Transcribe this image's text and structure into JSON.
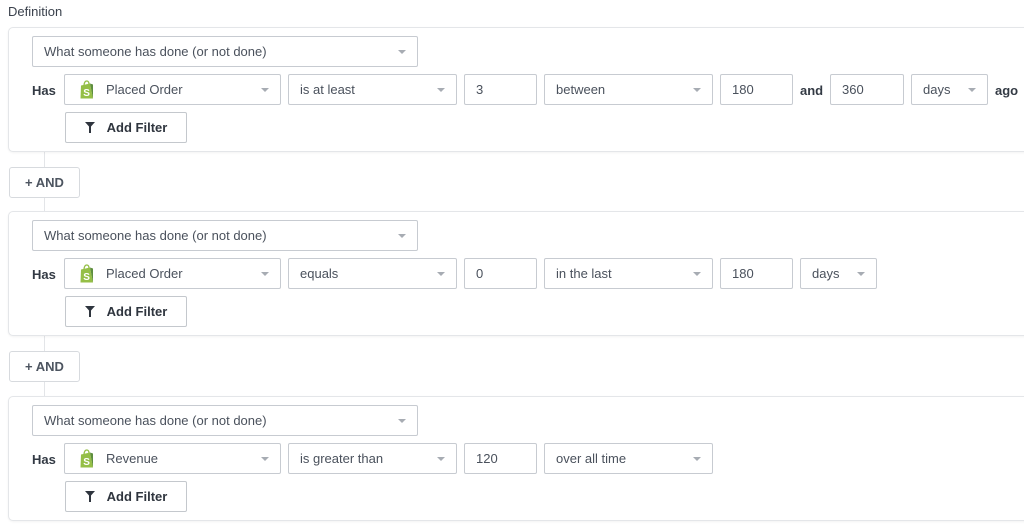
{
  "section_title": "Definition",
  "and_button_label": "+ AND",
  "add_filter_label": "Add Filter",
  "has_label": "Has",
  "colors": {
    "shopify_green": "#95bf47",
    "shopify_dark_green": "#5e8e3e",
    "border": "#c7cbd1",
    "text": "#4a515c"
  },
  "conditions": [
    {
      "condition_type": "What someone has done (or not done)",
      "event": {
        "label": "Placed Order",
        "icon": "shopify-icon"
      },
      "operator": "is at least",
      "value": "3",
      "timeframe": "between",
      "range_start": "180",
      "connector_word": "and",
      "range_end": "360",
      "unit": "days",
      "suffix": "ago"
    },
    {
      "condition_type": "What someone has done (or not done)",
      "event": {
        "label": "Placed Order",
        "icon": "shopify-icon"
      },
      "operator": "equals",
      "value": "0",
      "timeframe": "in the last",
      "range_value": "180",
      "unit": "days"
    },
    {
      "condition_type": "What someone has done (or not done)",
      "event": {
        "label": "Revenue",
        "icon": "shopify-icon"
      },
      "operator": "is greater than",
      "value": "120",
      "timeframe": "over all time"
    }
  ]
}
